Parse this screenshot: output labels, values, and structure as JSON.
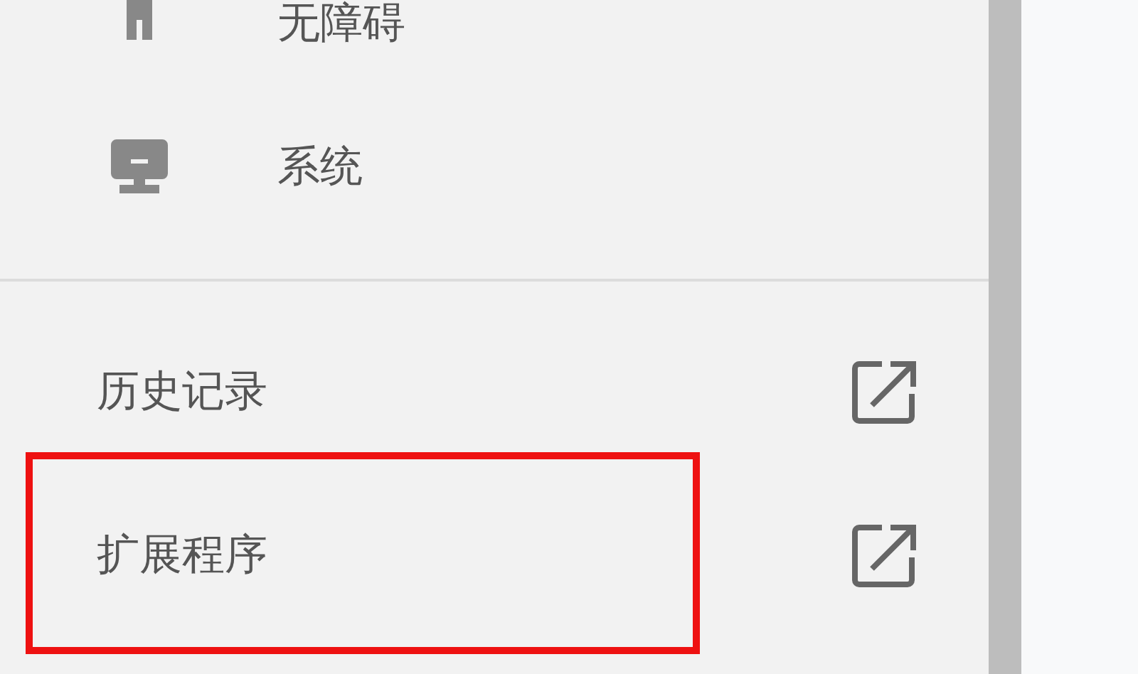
{
  "sidebar": {
    "items": [
      {
        "label": "无障碍",
        "kind": "accessibility"
      },
      {
        "label": "系统",
        "kind": "system"
      }
    ],
    "links": [
      {
        "label": "历史记录",
        "highlighted": false
      },
      {
        "label": "扩展程序",
        "highlighted": true
      }
    ]
  }
}
